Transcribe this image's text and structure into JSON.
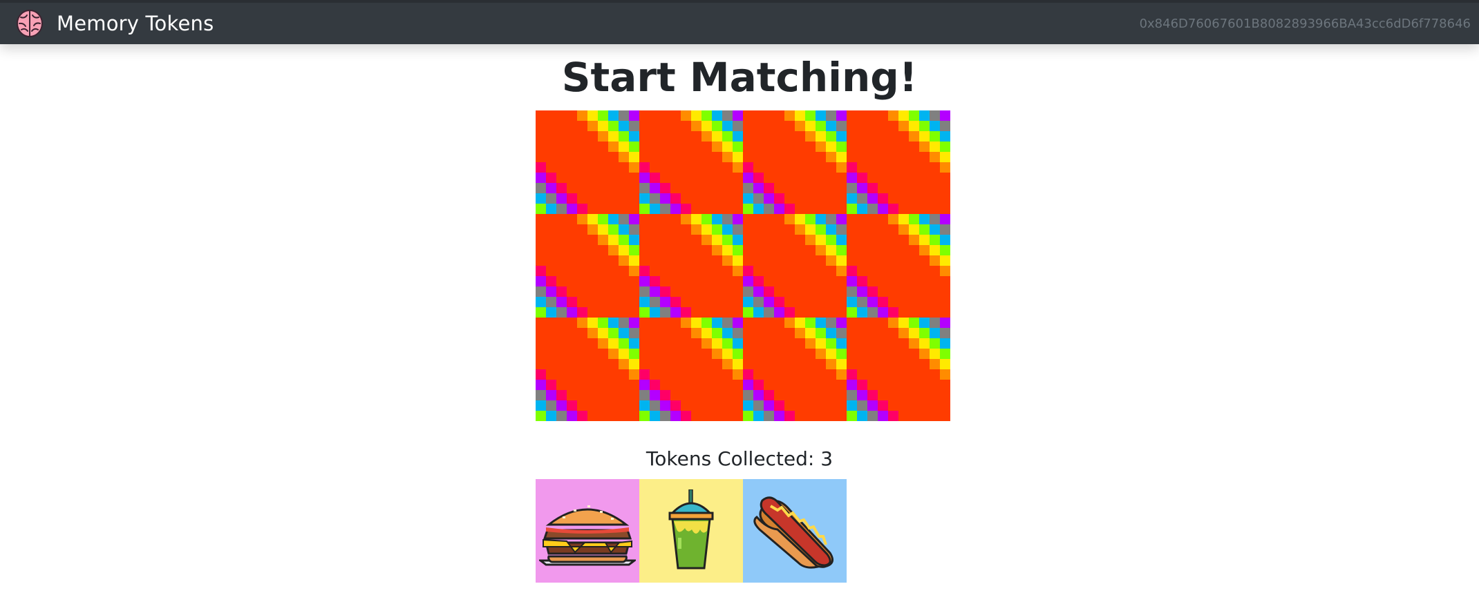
{
  "navbar": {
    "brand_icon": "brain-icon",
    "brand_title": "Memory Tokens",
    "account": "0x846D76067601B8082893966BA43cc6dD6f778646"
  },
  "game": {
    "heading": "Start Matching!",
    "board": {
      "rows": 3,
      "cols": 4,
      "card_back": "rainbow-checker-pattern"
    },
    "tokens_label": "Tokens Collected: 3",
    "tokens": [
      {
        "name": "burger",
        "icon": "burger-icon",
        "bg": "#f199ed"
      },
      {
        "name": "milkshake",
        "icon": "milkshake-icon",
        "bg": "#fcee88"
      },
      {
        "name": "hotdog",
        "icon": "hotdog-icon",
        "bg": "#8fc9f9"
      }
    ]
  },
  "colors": {
    "navbar_bg": "#343a40",
    "pattern": [
      "#e60000",
      "#ff3c00",
      "#ff8c00",
      "#ffea00",
      "#7fff00",
      "#00b4f0",
      "#808080",
      "#b400ff",
      "#ff0066"
    ]
  }
}
